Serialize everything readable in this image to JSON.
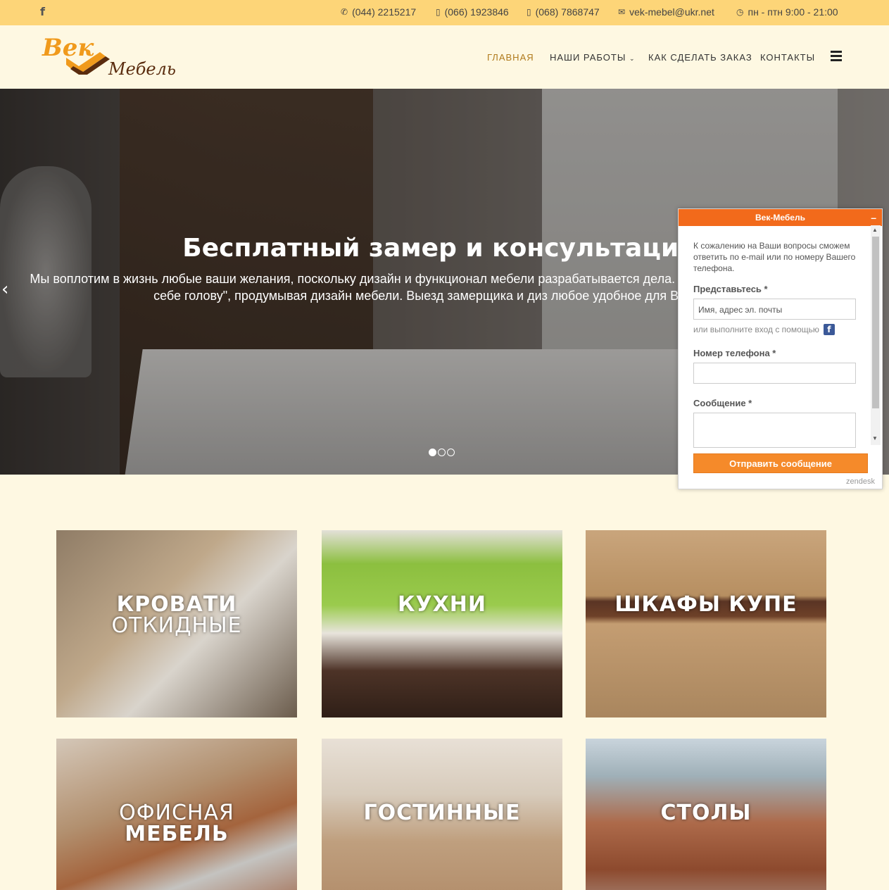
{
  "topbar": {
    "phone1": "(044) 2215217",
    "phone2": "(066) 1923846",
    "phone3": "(068) 7868747",
    "email": "vek-mebel@ukr.net",
    "hours": "пн - птн 9:00 - 21:00"
  },
  "logo": {
    "word1": "Век",
    "word2": "Мебель"
  },
  "nav": {
    "home": "ГЛАВНАЯ",
    "works": "НАШИ РАБОТЫ",
    "order": "КАК СДЕЛАТЬ ЗАКАЗ",
    "contacts": "КОНТАКТЫ"
  },
  "hero": {
    "title": "Бесплатный замер и консультация!",
    "text": "Мы воплотим в жизнь любые ваши желания, поскольку дизайн и функционал мебели разрабатывается дела. Вам больше не нужно \"ломать себе голову\", продумывая дизайн мебели. Выезд замерщика и диз любое удобное для Вас время.",
    "active_slide": 1,
    "slides": 3
  },
  "tiles": [
    {
      "line1": "КРОВАТИ",
      "line2": "ОТКИДНЫЕ"
    },
    {
      "line1": "КУХНИ"
    },
    {
      "line1": "ШКАФЫ КУПЕ"
    },
    {
      "line1": "ОФИСНАЯ",
      "line2": "МЕБЕЛЬ"
    },
    {
      "line1": "ГОСТИННЫЕ"
    },
    {
      "line1": "СТОЛЫ"
    }
  ],
  "chat": {
    "title": "Век-Мебель",
    "minimize": "–",
    "message": "К сожалению на Ваши вопросы сможем ответить по e-mail или по номеру Вашего телефона.",
    "name_label": "Представьтесь *",
    "name_placeholder": "Имя, адрес эл. почты",
    "alt_login": "или выполните вход с помощью",
    "phone_label": "Номер телефона *",
    "message_label": "Сообщение *",
    "submit": "Отправить сообщение",
    "brand": "zendesk"
  },
  "colors": {
    "topbar": "#fdd578",
    "background": "#fef8e2",
    "accent": "#f26a1b",
    "nav_active": "#b07a1c"
  }
}
